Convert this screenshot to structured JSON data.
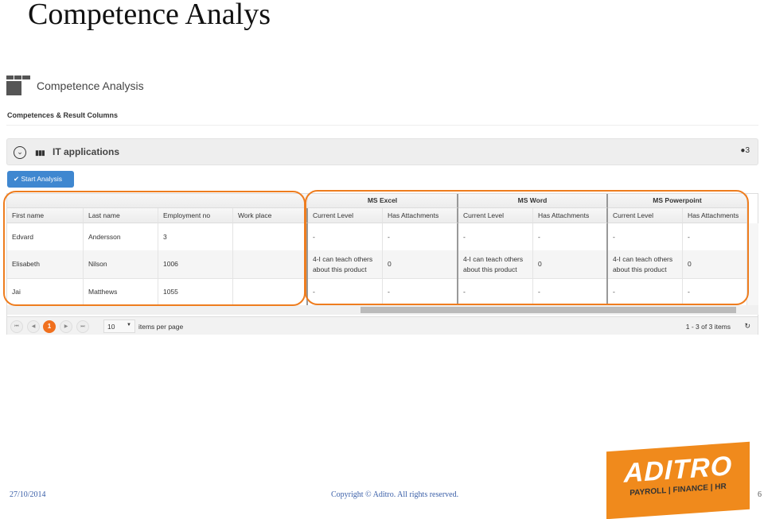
{
  "slide": {
    "title": "Competence Analys",
    "date": "27/10/2014",
    "copyright": "Copyright © Aditro. All rights reserved.",
    "page": "6"
  },
  "logo": {
    "name": "ADITRO",
    "tagline": "PAYROLL | FINANCE | HR"
  },
  "app": {
    "title": "Competence Analysis",
    "section": "Competences & Result Columns"
  },
  "group": {
    "title": "IT applications",
    "count": "3",
    "icons": [
      "chevron-down-circle",
      "group-icon",
      "user-icon"
    ]
  },
  "toolbar": {
    "start_label": "Start Analysis"
  },
  "grid": {
    "left_columns": [
      "First name",
      "Last name",
      "Employment no",
      "Work place"
    ],
    "groups": [
      {
        "name": "MS Excel",
        "columns": [
          "Current Level",
          "Has Attachments"
        ]
      },
      {
        "name": "MS Word",
        "columns": [
          "Current Level",
          "Has Attachments"
        ]
      },
      {
        "name": "MS Powerpoint",
        "columns": [
          "Current Level",
          "Has Attachments"
        ]
      }
    ],
    "rows": [
      {
        "left": [
          "Edvard",
          "Andersson",
          "3",
          ""
        ],
        "right": [
          "-",
          "-",
          "-",
          "-",
          "-",
          "-"
        ]
      },
      {
        "left": [
          "Elisabeth",
          "Nilson",
          "1006",
          ""
        ],
        "right": [
          "4-I can teach others about this product",
          "0",
          "4-I can teach others about this product",
          "0",
          "4-I can teach others about this product",
          "0"
        ]
      },
      {
        "left": [
          "Jai",
          "Matthews",
          "1055",
          ""
        ],
        "right": [
          "-",
          "-",
          "-",
          "-",
          "-",
          "-"
        ]
      }
    ]
  },
  "pager": {
    "current_page": "1",
    "page_size": "10",
    "page_size_label": "items per page",
    "summary": "1 - 3 of 3 items"
  },
  "colors": {
    "highlight": "#ee7d1f",
    "primary_button": "#3f87d0",
    "brand": "#f08a1c"
  }
}
